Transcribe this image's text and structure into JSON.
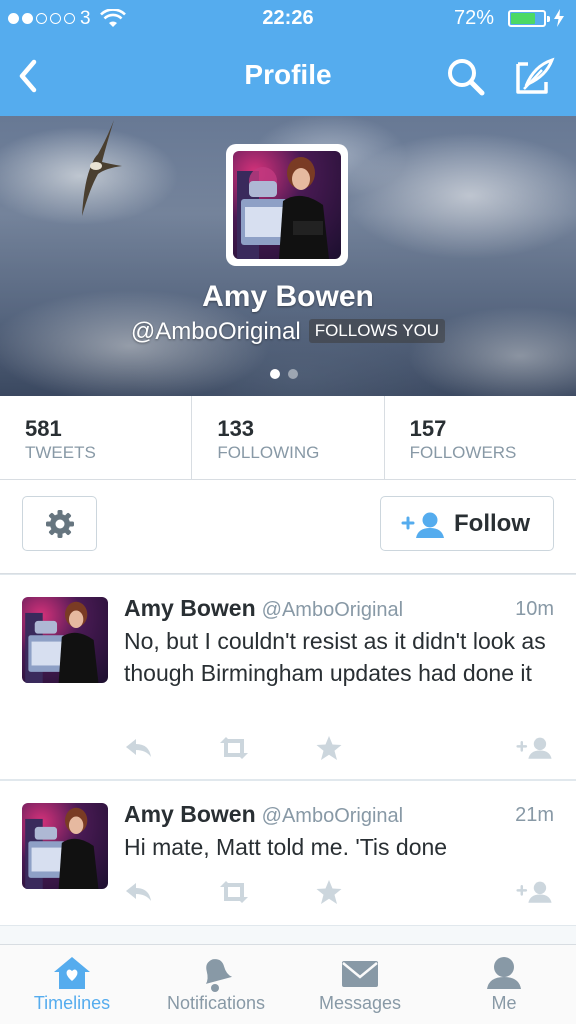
{
  "status_bar": {
    "carrier": "3",
    "time": "22:26",
    "battery_percent": "72%",
    "signal_bars_filled": 2,
    "signal_bars_total": 5,
    "battery_level": 0.72
  },
  "nav": {
    "title": "Profile",
    "back_icon": "chevron-left-icon",
    "search_icon": "search-icon",
    "compose_icon": "compose-icon"
  },
  "profile": {
    "name": "Amy Bowen",
    "handle": "@AmboOriginal",
    "follows_you_badge": "FOLLOWS YOU",
    "header_page": 1,
    "header_pages": 2
  },
  "stats": [
    {
      "value": "581",
      "label": "TWEETS"
    },
    {
      "value": "133",
      "label": "FOLLOWING"
    },
    {
      "value": "157",
      "label": "FOLLOWERS"
    }
  ],
  "actions": {
    "settings_icon": "gear-icon",
    "follow_label": "Follow",
    "follow_icon": "add-user-icon"
  },
  "tweets": [
    {
      "name": "Amy Bowen",
      "handle": "@AmboOriginal",
      "time": "10m",
      "text": "No, but I couldn't resist as it didn't look as though Birmingham updates had done it"
    },
    {
      "name": "Amy Bowen",
      "handle": "@AmboOriginal",
      "time": "21m",
      "text": "Hi mate, Matt told me. 'Tis done"
    }
  ],
  "tweet_action_icons": [
    "reply-icon",
    "retweet-icon",
    "favorite-icon",
    "follow-icon"
  ],
  "tabs": [
    {
      "label": "Timelines",
      "icon": "home-icon",
      "active": true
    },
    {
      "label": "Notifications",
      "icon": "bell-icon",
      "active": false
    },
    {
      "label": "Messages",
      "icon": "envelope-icon",
      "active": false
    },
    {
      "label": "Me",
      "icon": "person-icon",
      "active": false
    }
  ],
  "colors": {
    "brand_blue": "#55acee",
    "text_dark": "#292f33",
    "text_gray": "#8899a6",
    "battery_green": "#4cd964"
  }
}
